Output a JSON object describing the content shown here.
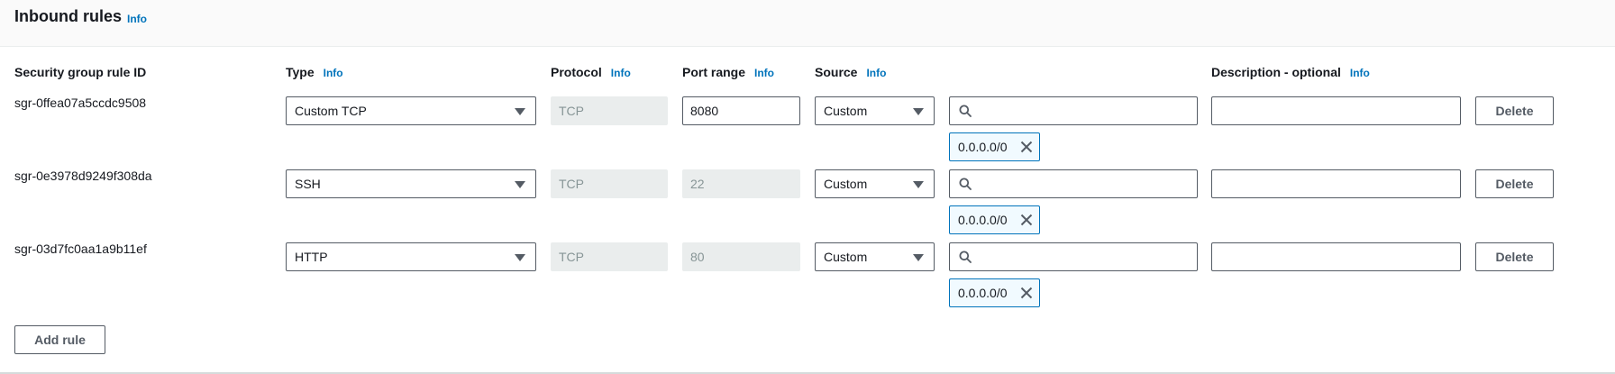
{
  "panel": {
    "title": "Inbound rules",
    "info_label": "Info"
  },
  "columns": {
    "rule_id": "Security group rule ID",
    "type": "Type",
    "protocol": "Protocol",
    "port_range": "Port range",
    "source": "Source",
    "description": "Description - optional",
    "info_label": "Info"
  },
  "rules": [
    {
      "id": "sgr-0ffea07a5ccdc9508",
      "type": "Custom TCP",
      "protocol": "TCP",
      "port_range": "8080",
      "port_editable": true,
      "source_type": "Custom",
      "search_value": "",
      "cidr": "0.0.0.0/0",
      "description": "",
      "delete_label": "Delete"
    },
    {
      "id": "sgr-0e3978d9249f308da",
      "type": "SSH",
      "protocol": "TCP",
      "port_range": "22",
      "port_editable": false,
      "source_type": "Custom",
      "search_value": "",
      "cidr": "0.0.0.0/0",
      "description": "",
      "delete_label": "Delete"
    },
    {
      "id": "sgr-03d7fc0aa1a9b11ef",
      "type": "HTTP",
      "protocol": "TCP",
      "port_range": "80",
      "port_editable": false,
      "source_type": "Custom",
      "search_value": "",
      "cidr": "0.0.0.0/0",
      "description": "",
      "delete_label": "Delete"
    }
  ],
  "add_rule_label": "Add rule",
  "icons": {
    "search": "search-icon",
    "remove_token": "close-icon",
    "dropdown": "caret-down-icon"
  },
  "colors": {
    "link": "#0073bb",
    "border": "#545b64",
    "disabled_bg": "#eaeded",
    "token_bg": "#f1faff"
  }
}
